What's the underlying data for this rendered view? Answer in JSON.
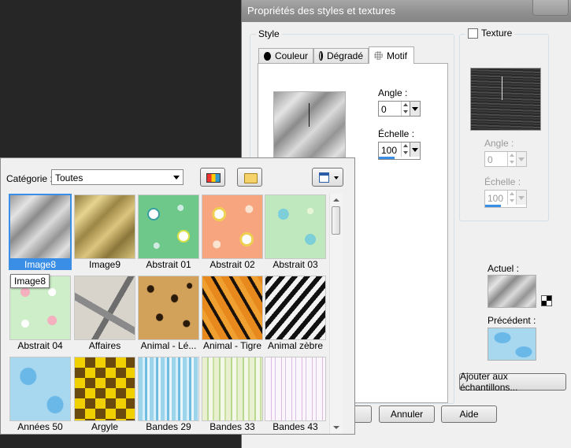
{
  "dialog": {
    "title": "Propriétés des styles et textures",
    "style_group": {
      "label": "Style",
      "tabs": [
        {
          "label": "Couleur",
          "active": false
        },
        {
          "label": "Dégradé",
          "active": false
        },
        {
          "label": "Motif",
          "active": true
        }
      ],
      "angle_label": "Angle :",
      "angle_value": "0",
      "scale_label": "Échelle :",
      "scale_value": "100"
    },
    "texture_group": {
      "checkbox_label": "Texture",
      "checked": false,
      "angle_label": "Angle :",
      "angle_value": "0",
      "scale_label": "Échelle :",
      "scale_value": "100"
    },
    "current_label": "Actuel :",
    "previous_label": "Précédent :",
    "add_swatches_button": "Ajouter aux échantillons...",
    "buttons": {
      "cancel": "Annuler",
      "help": "Aide"
    }
  },
  "palette": {
    "category_label": "Catégorie :",
    "category_value": "Toutes",
    "tooltip": "Image8",
    "items": [
      {
        "name": "Image8",
        "selected": true
      },
      {
        "name": "Image9"
      },
      {
        "name": "Abstrait 01"
      },
      {
        "name": "Abstrait 02"
      },
      {
        "name": "Abstrait 03"
      },
      {
        "name": "Abstrait 04"
      },
      {
        "name": "Affaires"
      },
      {
        "name": "Animal - Lé..."
      },
      {
        "name": "Animal - Tigre"
      },
      {
        "name": "Animal zèbre"
      },
      {
        "name": "Années 50"
      },
      {
        "name": "Argyle"
      },
      {
        "name": "Bandes 29"
      },
      {
        "name": "Bandes 33"
      },
      {
        "name": "Bandes 43"
      }
    ]
  },
  "colors": {
    "selection": "#3a8ee6",
    "titlebar": "#8e8e8e",
    "background": "#262626"
  }
}
